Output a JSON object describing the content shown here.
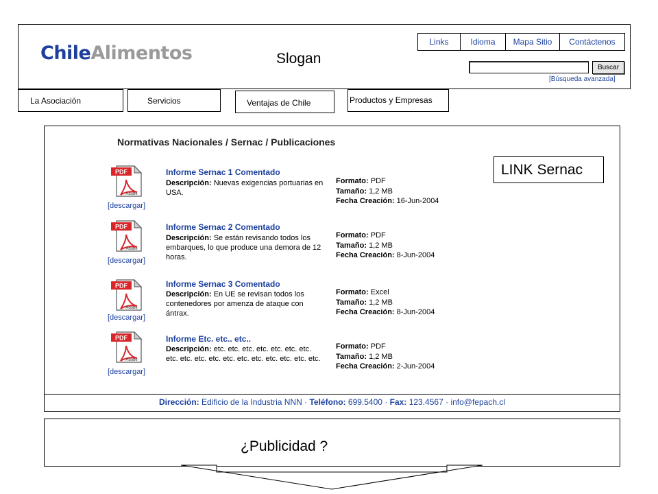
{
  "header": {
    "logo_part1": "Chile",
    "logo_part2": "Alimentos",
    "slogan": "Slogan",
    "top_links": [
      "Links",
      "Idioma",
      "Mapa Sitio",
      "Contáctenos"
    ],
    "search_button": "Buscar",
    "search_value": "",
    "advanced_search": "[Búsqueda avanzada]"
  },
  "nav": {
    "tabs": [
      "La Asociación",
      "Servicios",
      "Ventajas de Chile",
      "Productos y Empresas"
    ]
  },
  "main": {
    "title": "Normativas Nacionales / Sernac / Publicaciones",
    "link_box": "LINK Sernac",
    "download_label": "[descargar]",
    "desc_label": "Descripción:",
    "format_label": "Formato:",
    "size_label": "Tamaño:",
    "date_label": "Fecha Creación:",
    "items": [
      {
        "title": "Informe Sernac 1 Comentado",
        "description": "Nuevas exigencias portuarias en USA.",
        "format": "PDF",
        "size": "1,2 MB",
        "date": "16-Jun-2004"
      },
      {
        "title": "Informe Sernac 2 Comentado",
        "description": "Se están revisando todos los embarques, lo que produce una demora de 12 horas.",
        "format": "PDF",
        "size": "1,2 MB",
        "date": "8-Jun-2004"
      },
      {
        "title": "Informe Sernac 3 Comentado",
        "description": "En UE se revisan todos los contenedores por amenza de ataque con ántrax.",
        "format": "Excel",
        "size": "1,2 MB",
        "date": "8-Jun-2004"
      },
      {
        "title": "Informe Etc. etc.. etc..",
        "description": "etc. etc. etc. etc. etc. etc. etc. etc. etc. etc. etc. etc. etc. etc. etc. etc. etc. etc.",
        "format": "PDF",
        "size": "1,2 MB",
        "date": "2-Jun-2004"
      }
    ]
  },
  "footer": {
    "address_label": "Dirección:",
    "address": "Edificio de la Industria NNN",
    "phone_label": "Teléfono:",
    "phone": "699.5400",
    "fax_label": "Fax:",
    "fax": "123.4567",
    "email": "info@fepach.cl"
  },
  "publicidad": {
    "text": "¿Publicidad ?"
  },
  "icons": {
    "pdf_badge": "PDF",
    "pdf_brand": "Adobe"
  },
  "colors": {
    "brand_blue": "#1e3f9c",
    "link_blue": "#1a3f9c",
    "logo_grey": "#9a9a9a",
    "pdf_red": "#d8262b"
  }
}
